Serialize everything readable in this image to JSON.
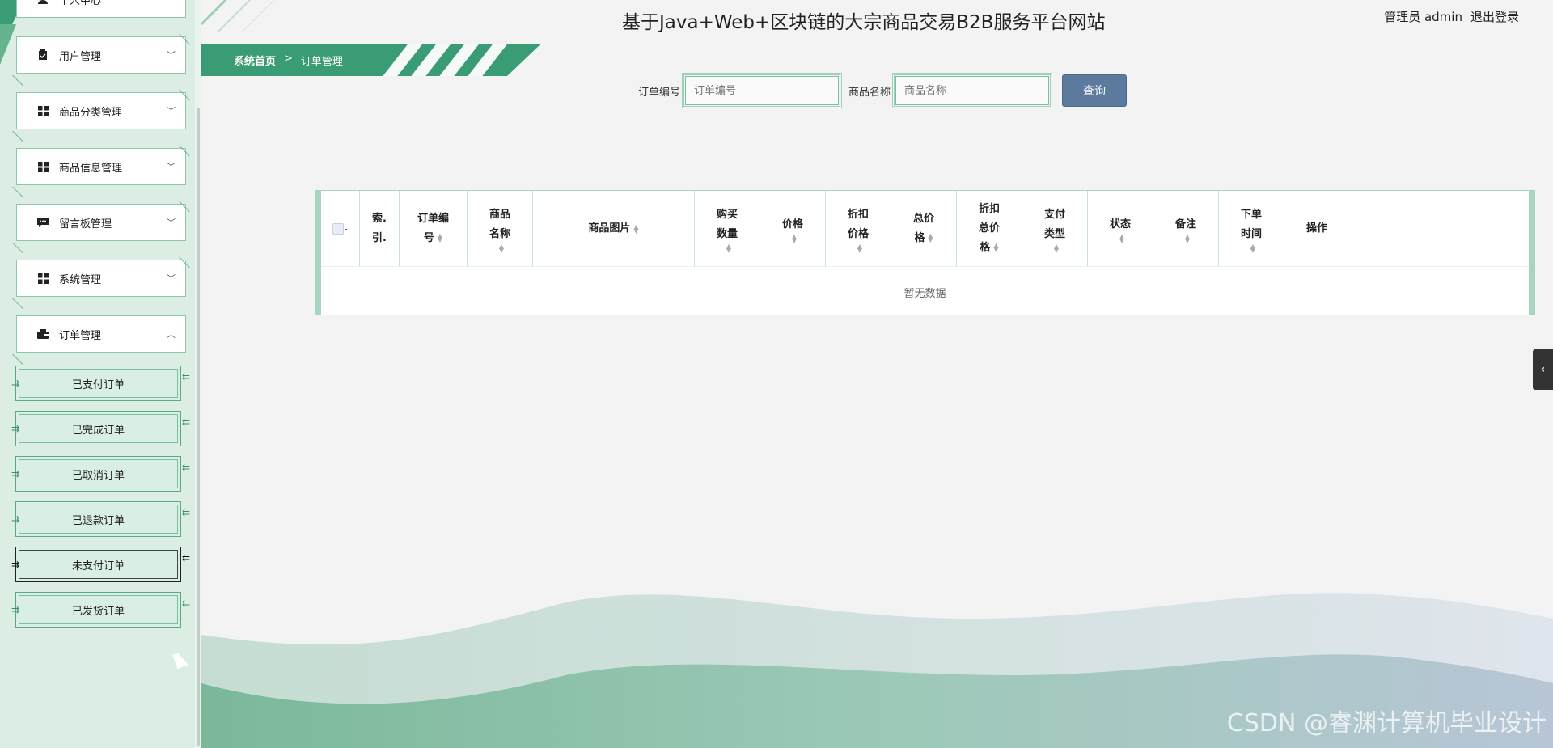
{
  "header": {
    "title": "基于Java+Web+区块链的大宗商品交易B2B服务平台网站",
    "user_label": "管理员 admin",
    "logout": "退出登录"
  },
  "breadcrumb": {
    "home": "系统首页",
    "sep": ">",
    "current": "订单管理"
  },
  "sidebar": {
    "top_partial": "个人中心",
    "items": [
      {
        "label": "用户管理",
        "icon": "clipboard-icon",
        "chevron": "﹀"
      },
      {
        "label": "商品分类管理",
        "icon": "grid-icon",
        "chevron": "﹀"
      },
      {
        "label": "商品信息管理",
        "icon": "grid-icon",
        "chevron": "﹀"
      },
      {
        "label": "留言板管理",
        "icon": "message-icon",
        "chevron": "﹀"
      },
      {
        "label": "系统管理",
        "icon": "grid-icon",
        "chevron": "﹀"
      },
      {
        "label": "订单管理",
        "icon": "wallet-icon",
        "chevron": "︿"
      }
    ],
    "sub_items": [
      {
        "label": "已支付订单"
      },
      {
        "label": "已完成订单"
      },
      {
        "label": "已取消订单"
      },
      {
        "label": "已退款订单"
      },
      {
        "label": "未支付订单"
      },
      {
        "label": "已发货订单"
      }
    ]
  },
  "search": {
    "order_no_label": "订单编号",
    "order_no_placeholder": "订单编号",
    "product_name_label": "商品名称",
    "product_name_placeholder": "商品名称",
    "query_button": "查询"
  },
  "table": {
    "columns": {
      "index_a": "索.",
      "index_b": "引.",
      "order_no_a": "订单编",
      "order_no_b": "号",
      "product_name_a": "商品",
      "product_name_b": "名称",
      "product_image": "商品图片",
      "quantity_a": "购买",
      "quantity_b": "数量",
      "price": "价格",
      "discount_price_a": "折扣",
      "discount_price_b": "价格",
      "total_a": "总价",
      "total_b": "格",
      "discount_total_a": "折扣",
      "discount_total_b": "总价",
      "discount_total_c": "格",
      "pay_type_a": "支付",
      "pay_type_b": "类型",
      "status": "状态",
      "remark": "备注",
      "order_time_a": "下单",
      "order_time_b": "时间",
      "actions": "操作"
    },
    "empty_text": "暂无数据"
  },
  "collapse_glyph": "‹",
  "watermark": "CSDN @睿渊计算机毕业设计",
  "colors": {
    "accent": "#3a9c74",
    "button": "#5b7a9e",
    "sidebar_bg": "#dcede4"
  }
}
